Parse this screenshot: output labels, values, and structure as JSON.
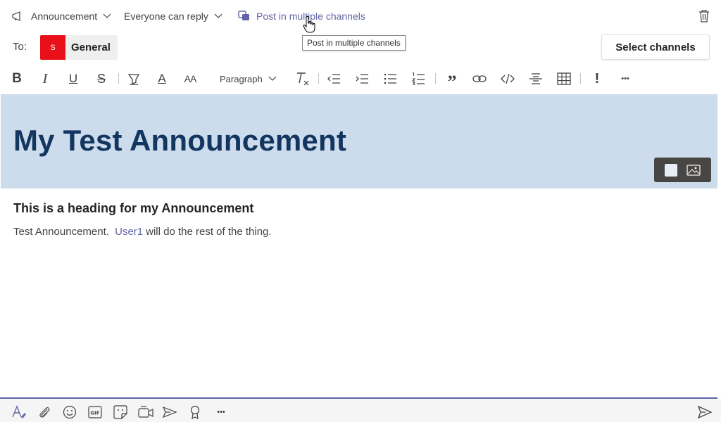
{
  "compose": {
    "post_type_label": "Announcement",
    "reply_setting_label": "Everyone can reply",
    "multi_channel_label": "Post in multiple channels",
    "tooltip": "Post in multiple channels",
    "to_label": "To:",
    "channel": {
      "avatar_letter": "S",
      "name": "General",
      "avatar_color": "#e8111a"
    },
    "select_channels_label": "Select channels"
  },
  "toolbar": {
    "paragraph_label": "Paragraph",
    "bold_glyph": "B",
    "italic_glyph": "I",
    "underline_glyph": "U",
    "strike_glyph": "S",
    "font_color_glyph": "A",
    "font_size_glyph": "AA",
    "important_glyph": "!",
    "quote_glyph": "”",
    "more_glyph": "•••"
  },
  "announcement": {
    "headline": "My Test Announcement",
    "banner_color": "#cddcec",
    "headline_color": "#12365f"
  },
  "body": {
    "heading": "This is a heading for my Announcement",
    "text_before": "Test Announcement.",
    "mention": "User1",
    "text_after": "will do the rest of the thing."
  },
  "bottom": {
    "more_glyph": "•••"
  },
  "theme": {
    "accent": "#6264a7"
  }
}
